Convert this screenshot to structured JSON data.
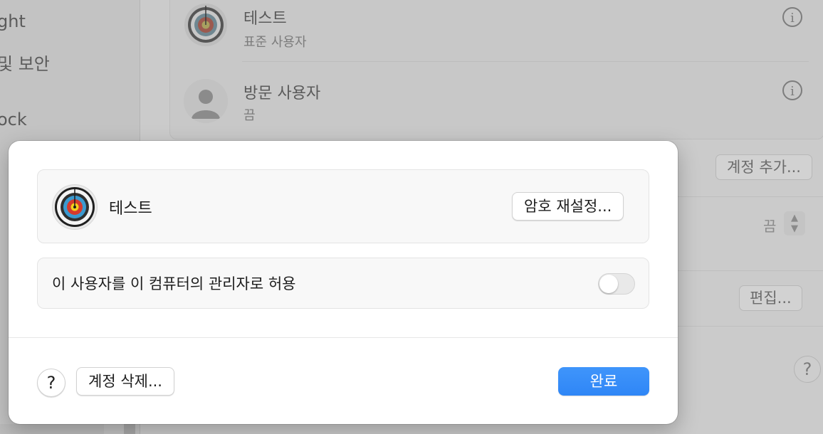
{
  "sidebar": {
    "items": [
      "ght",
      "및 보안",
      "ock"
    ]
  },
  "users": [
    {
      "name": "테스트",
      "role": "표준 사용자",
      "avatar_icon": "target-icon"
    },
    {
      "name": "방문 사용자",
      "role": "끔",
      "avatar_icon": "person-icon"
    }
  ],
  "background": {
    "add_account_label": "계정 추가...",
    "popup_value": "끔",
    "edit_label": "편집...",
    "help_label": "?"
  },
  "sheet": {
    "user_name": "테스트",
    "reset_password_label": "암호 재설정...",
    "admin_toggle_label": "이 사용자를 이 컴퓨터의 관리자로 허용",
    "admin_toggle_on": false,
    "help_label": "?",
    "delete_account_label": "계정 삭제...",
    "done_label": "완료"
  },
  "colors": {
    "accent": "#2f86f6",
    "dimmed_background": "#c9c9c9"
  }
}
